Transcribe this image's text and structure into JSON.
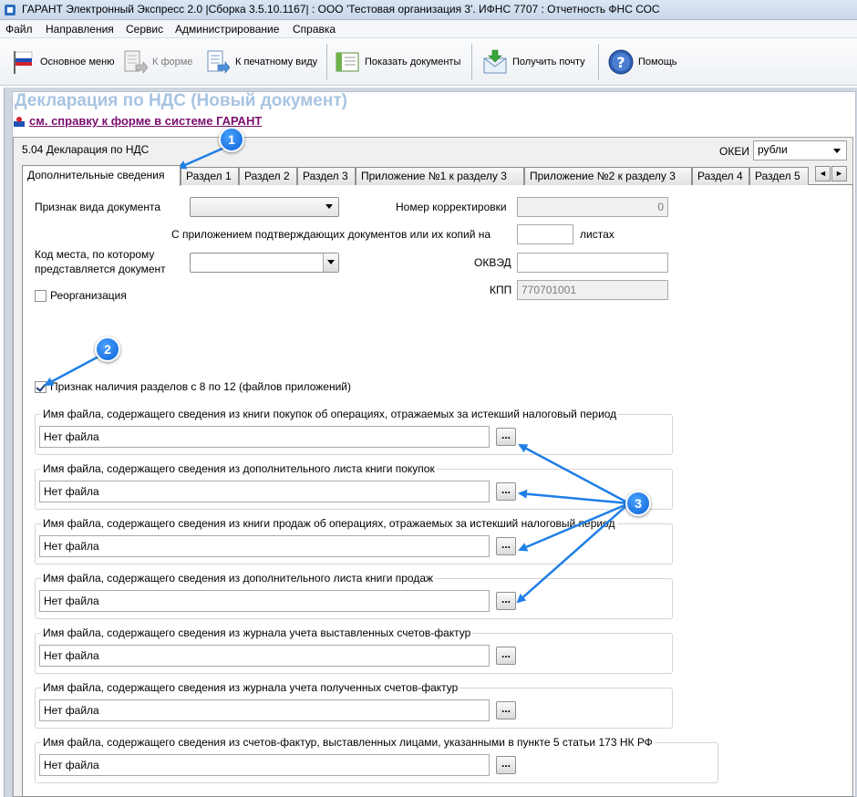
{
  "window": {
    "title": "ГАРАНТ Электронный Экспресс 2.0 |Сборка 3.5.10.1167|  :  ООО 'Тестовая организация 3'. ИФНС 7707  :  Отчетность ФНС СОС"
  },
  "menu": [
    "Файл",
    "Направления",
    "Сервис",
    "Администрирование",
    "Справка"
  ],
  "toolbar": {
    "main_menu": "Основное меню",
    "to_form": "К форме",
    "print_view": "К печатному виду",
    "show_docs": "Показать документы",
    "get_mail": "Получить почту",
    "help": "Помощь"
  },
  "form": {
    "title": "Декларация по НДС (Новый документ)",
    "help_link": "см. справку к форме в системе ГАРАНТ",
    "section_title": "5.04 Декларация по НДС",
    "okei_label": "ОКЕИ",
    "okei_value": "рубли"
  },
  "tabs": [
    "Дополнительные сведения",
    "Раздел 1",
    "Раздел 2",
    "Раздел 3",
    "Приложение №1 к разделу 3",
    "Приложение №2 к разделу 3",
    "Раздел 4",
    "Раздел 5"
  ],
  "fields": {
    "doc_type_label": "Признак вида документа",
    "doc_type_value": "",
    "correction_label": "Номер корректировки",
    "correction_value": "0",
    "attach_label": "С приложением подтверждающих документов или их копий на",
    "attach_value": "",
    "sheets_label": "листах",
    "place_label_1": "Код места, по которому",
    "place_label_2": "представляется документ",
    "place_value": "",
    "okved_label": "ОКВЭД",
    "okved_value": "",
    "kpp_label": "КПП",
    "kpp_value": "770701001",
    "reorg_label": "Реорганизация",
    "sections_flag_label": "Признак наличия разделов с 8 по 12 (файлов приложений)"
  },
  "files": [
    {
      "label": "Имя файла, содержащего сведения из книги покупок об операциях, отражаемых за истекший налоговый период",
      "value": "Нет файла"
    },
    {
      "label": "Имя файла, содержащего сведения из дополнительного листа книги покупок",
      "value": "Нет файла"
    },
    {
      "label": "Имя файла, содержащего сведения из книги продаж об операциях, отражаемых за истекший налоговый период",
      "value": "Нет файла"
    },
    {
      "label": "Имя файла, содержащего сведения из дополнительного листа книги продаж",
      "value": "Нет файла"
    },
    {
      "label": "Имя файла, содержащего сведения из журнала учета выставленных счетов-фактур",
      "value": "Нет файла"
    },
    {
      "label": "Имя файла, содержащего сведения из журнала учета полученных счетов-фактур",
      "value": "Нет файла"
    },
    {
      "label": "Имя файла, содержащего сведения из счетов-фактур, выставленных лицами, указанными в пункте 5 статьи 173 НК РФ",
      "value": "Нет файла"
    }
  ],
  "browse_label": "...",
  "tab_scroll": {
    "left": "◄",
    "right": "►"
  },
  "annotations": [
    "1",
    "2",
    "3"
  ],
  "colors": {
    "badge": "#0b62d6",
    "arrow": "#1f7fe6",
    "title": "#a8c4e2",
    "link": "#7a0e6e"
  }
}
